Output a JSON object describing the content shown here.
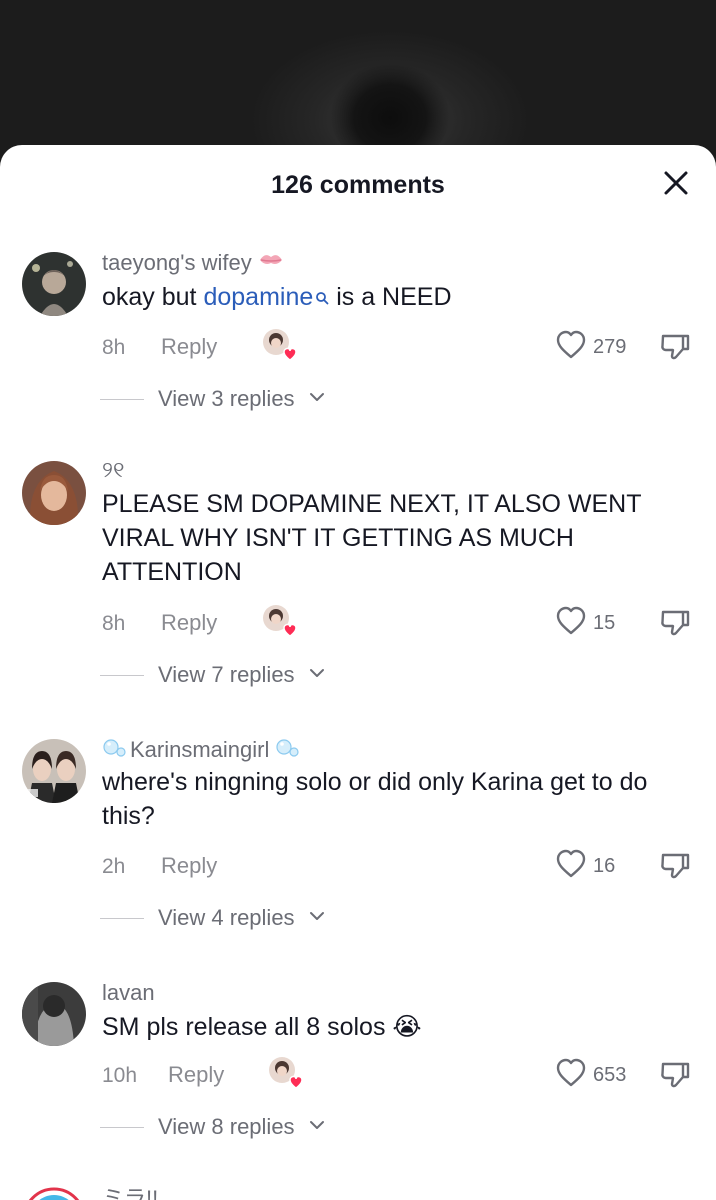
{
  "header": {
    "title": "126 comments"
  },
  "colors": {
    "link": "#2b5db9",
    "heart_badge": "#fe2c55",
    "muted": "#8a8b91"
  },
  "comments": [
    {
      "username": "taeyong's wifey",
      "username_icon": "kiss-mark-icon",
      "text_before": "okay but ",
      "link": "dopamine",
      "text_after": " is a NEED",
      "time": "8h",
      "reply": "Reply",
      "likes": "279",
      "view_replies": "View 3 replies"
    },
    {
      "username": "୨୧",
      "text": "PLEASE SM DOPAMINE NEXT, IT ALSO WENT VIRAL WHY ISN'T IT GETTING AS MUCH ATTENTION",
      "time": "8h",
      "reply": "Reply",
      "likes": "15",
      "view_replies": "View 7 replies"
    },
    {
      "username": "Karinsmaingirl",
      "username_icon": "bubbles-icon",
      "text": "where's ningning solo or did only Karina get to do this?",
      "time": "2h",
      "reply": "Reply",
      "likes": "16",
      "view_replies": "View 4 replies"
    },
    {
      "username": "lavan",
      "text": "SM pls release all 8 solos",
      "emoji": "😭",
      "time": "10h",
      "reply": "Reply",
      "likes": "653",
      "view_replies": "View 8 replies"
    },
    {
      "username": "ミラ!!"
    }
  ]
}
